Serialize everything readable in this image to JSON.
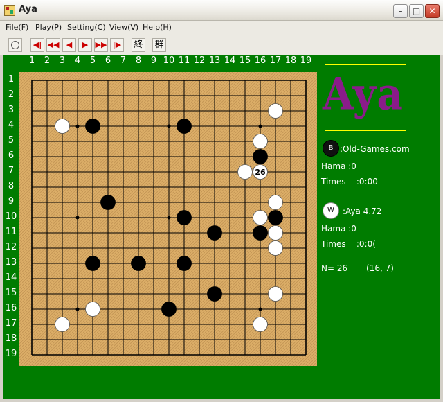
{
  "window": {
    "title": "Aya"
  },
  "menu": [
    "File(F)",
    "Play(P)",
    "Setting(C)",
    "View(V)",
    "Help(H)"
  ],
  "toolbar": {
    "buttons": [
      "◀|",
      "◀◀",
      "◀",
      "▶",
      "▶▶",
      "|▶"
    ],
    "kanji_end": "終",
    "kanji_group": "群"
  },
  "board": {
    "size": 19,
    "col_labels": [
      "1",
      "2",
      "3",
      "4",
      "5",
      "6",
      "7",
      "8",
      "9",
      "10",
      "11",
      "12",
      "13",
      "14",
      "15",
      "16",
      "17",
      "18",
      "19"
    ],
    "row_labels": [
      "1",
      "2",
      "3",
      "4",
      "5",
      "6",
      "7",
      "8",
      "9",
      "10",
      "11",
      "12",
      "13",
      "14",
      "15",
      "16",
      "17",
      "18",
      "19"
    ],
    "hoshi": [
      [
        4,
        4
      ],
      [
        10,
        4
      ],
      [
        16,
        4
      ],
      [
        4,
        10
      ],
      [
        10,
        10
      ],
      [
        16,
        10
      ],
      [
        4,
        16
      ],
      [
        10,
        16
      ],
      [
        16,
        16
      ]
    ],
    "black_stones": [
      [
        5,
        4
      ],
      [
        11,
        4
      ],
      [
        16,
        6
      ],
      [
        6,
        9
      ],
      [
        11,
        10
      ],
      [
        17,
        10
      ],
      [
        13,
        11
      ],
      [
        16,
        11
      ],
      [
        5,
        13
      ],
      [
        8,
        13
      ],
      [
        11,
        13
      ],
      [
        13,
        15
      ],
      [
        10,
        16
      ]
    ],
    "white_stones": [
      [
        17,
        3
      ],
      [
        3,
        4
      ],
      [
        16,
        5
      ],
      [
        15,
        7
      ],
      [
        17,
        9
      ],
      [
        16,
        10
      ],
      [
        17,
        11
      ],
      [
        17,
        12
      ],
      [
        17,
        15
      ],
      [
        5,
        16
      ],
      [
        3,
        17
      ],
      [
        16,
        17
      ]
    ],
    "last_move": {
      "point": [
        16,
        7
      ],
      "label": "26",
      "color": "white"
    }
  },
  "panel": {
    "logo": "Aya",
    "black": {
      "stone_label": "B",
      "name": ":Old-Games.com",
      "hama": "Hama :0",
      "times": "Times    :0:00"
    },
    "white": {
      "stone_label": "W",
      "name": ":Aya 4.72",
      "hama": "Hama :0",
      "times": "Times    :0:0("
    },
    "move_count": "N= 26",
    "move_coord": "(16, 7)"
  },
  "colors": {
    "felt": "#007c00",
    "board": "#dcae68",
    "logo": "#8a1c8a",
    "accent_line": "#ffff00"
  }
}
